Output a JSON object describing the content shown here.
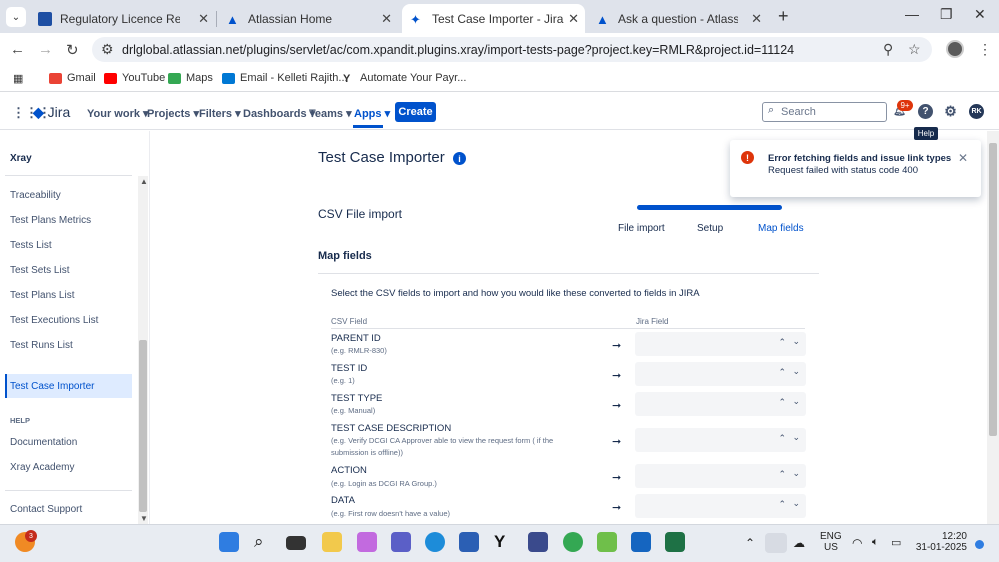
{
  "browser": {
    "tabs": [
      {
        "title": "Regulatory Licence Request Cre",
        "active": false
      },
      {
        "title": "Atlassian Home",
        "active": false
      },
      {
        "title": "Test Case Importer - Jira",
        "active": true
      },
      {
        "title": "Ask a question - Atlassian Com",
        "active": false
      }
    ],
    "url": "drlglobal.atlassian.net/plugins/servlet/ac/com.xpandit.plugins.xray/import-tests-page?project.key=RMLR&project.id=11124",
    "bookmarks": [
      "Gmail",
      "YouTube",
      "Maps",
      "Email - Kelleti Rajith...",
      "Automate Your Payr..."
    ]
  },
  "jira": {
    "logo": "Jira",
    "nav": [
      "Your work",
      "Projects",
      "Filters",
      "Dashboards",
      "Teams",
      "Apps"
    ],
    "create_label": "Create",
    "search_placeholder": "Search",
    "notif_count": "9+",
    "tooltip": "Help",
    "user_initials": "RK"
  },
  "sidebar": {
    "title": "Xray",
    "items": [
      "Traceability",
      "Test Plans Metrics",
      "Tests List",
      "Test Sets List",
      "Test Plans List",
      "Test Executions List",
      "Test Runs List"
    ],
    "active_item": "Test Case Importer",
    "help_heading": "HELP",
    "help_items": [
      "Documentation",
      "Xray Academy"
    ],
    "contact": "Contact Support"
  },
  "main": {
    "title": "Test Case Importer",
    "section": "CSV File import",
    "steps": [
      "File import",
      "Setup",
      "Map fields"
    ],
    "map_title": "Map fields",
    "description": "Select the CSV fields to import and how you would like these converted to fields in JIRA",
    "col_csv": "CSV Field",
    "col_jira": "Jira Field",
    "fields": [
      {
        "name": "PARENT ID",
        "example": "(e.g. RMLR-830)"
      },
      {
        "name": "TEST ID",
        "example": "(e.g. 1)"
      },
      {
        "name": "TEST TYPE",
        "example": "(e.g. Manual)"
      },
      {
        "name": "TEST CASE DESCRIPTION",
        "example": "(e.g. Verify DCGI CA Approver able to view the request form ( if the submission is offline))"
      },
      {
        "name": "ACTION",
        "example": "(e.g. Login as DCGI RA Group.)"
      },
      {
        "name": "DATA",
        "example": "(e.g. First row doesn't have a value)"
      }
    ]
  },
  "toast": {
    "title": "Error fetching fields and issue link types",
    "body": "Request failed with status code 400"
  },
  "taskbar": {
    "lang": "ENG",
    "region": "US",
    "time": "12:20",
    "date": "31-01-2025",
    "widget_badge": "3"
  }
}
